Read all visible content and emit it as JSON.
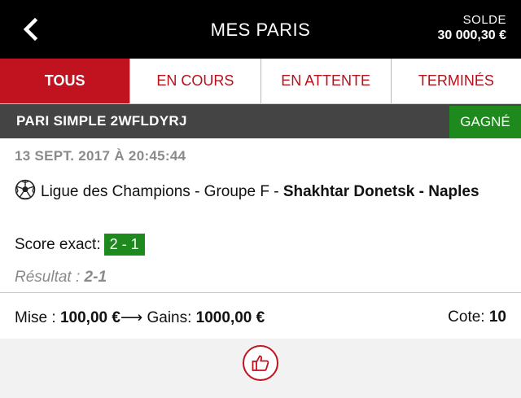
{
  "header": {
    "title": "MES PARIS",
    "balance_label": "SOLDE",
    "balance_value": "30 000,30 €"
  },
  "tabs": [
    {
      "label": "TOUS",
      "active": true
    },
    {
      "label": "EN COURS",
      "active": false
    },
    {
      "label": "EN ATTENTE",
      "active": false
    },
    {
      "label": "TERMINÉS",
      "active": false
    }
  ],
  "bet": {
    "title": "PARI SIMPLE 2WFLDYRJ",
    "status": "GAGNÉ",
    "date": "13 SEPT. 2017 À 20:45:44",
    "competition": "Ligue des Champions - Groupe F - ",
    "teams": "Shakhtar Donetsk - Naples",
    "bet_type_label": "Score exact:",
    "bet_pick": "2 - 1",
    "result_label": "Résultat :",
    "result_value": "2-1"
  },
  "summary": {
    "stake_label": "Mise :",
    "stake_value": "100,00 €",
    "arrow": "⟶",
    "gains_label": "Gains:",
    "gains_value": "1000,00 €",
    "odds_label": "Cote:",
    "odds_value": "10"
  },
  "colors": {
    "brand_red": "#c1121f",
    "win_green": "#1e8a1e",
    "bar_grey": "#444444"
  },
  "icons": {
    "back": "chevron-left-icon",
    "sport": "soccer-ball-icon",
    "like": "thumbs-up-icon"
  }
}
